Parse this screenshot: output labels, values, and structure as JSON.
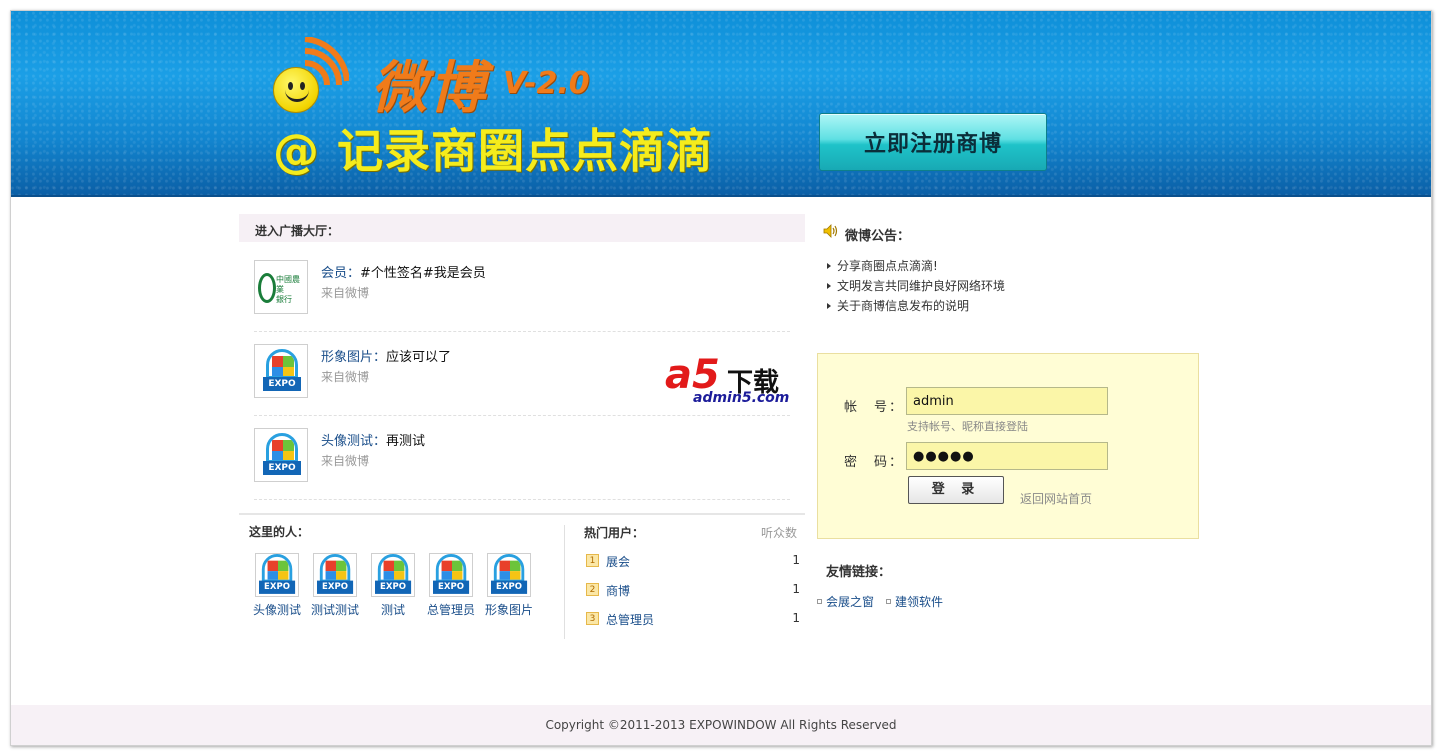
{
  "banner": {
    "brand": "微博",
    "version": "V-2.0",
    "slogan": "@ 记录商圈点点滴滴",
    "register_button": "立即注册商博"
  },
  "hall": {
    "title": "进入广播大厅：",
    "posts": [
      {
        "author": "会员：",
        "content": "#个性签名#我是会员",
        "source": "来自微博",
        "avatar": "bank-logo"
      },
      {
        "author": "形象图片：",
        "content": "应该可以了",
        "source": "来自微博",
        "avatar": "expo-logo"
      },
      {
        "author": "头像测试：",
        "content": "再测试",
        "source": "来自微博",
        "avatar": "expo-logo"
      }
    ]
  },
  "watermark": {
    "mark": "a5",
    "text": "下载",
    "url": "admin5.com"
  },
  "people": {
    "title": "这里的人：",
    "items": [
      "头像测试",
      "测试测试",
      "测试",
      "总管理员",
      "形象图片"
    ]
  },
  "hot_users": {
    "title": "热门用户：",
    "listen_label": "听众数",
    "items": [
      {
        "rank": "1",
        "name": "展会",
        "count": "1"
      },
      {
        "rank": "2",
        "name": "商博",
        "count": "1"
      },
      {
        "rank": "3",
        "name": "总管理员",
        "count": "1"
      }
    ]
  },
  "notice": {
    "title": "微博公告：",
    "items": [
      "分享商圈点点滴滴!",
      "文明发言共同维护良好网络环境",
      "关于商博信息发布的说明"
    ]
  },
  "login": {
    "account_label": "帐　号：",
    "account_value": "admin",
    "account_hint": "支持帐号、昵称直接登陆",
    "password_label": "密　码：",
    "password_value": "●●●●●",
    "submit_label": "登 录",
    "back_link": "返回网站首页"
  },
  "friend_links": {
    "title": "友情链接：",
    "items": [
      "会展之窗",
      "建领软件"
    ]
  },
  "footer": {
    "copyright": "Copyright ©2011-2013 EXPOWINDOW All Rights Reserved"
  },
  "colors": {
    "accent": "#1b9fe6",
    "brand": "#f07b1a",
    "slogan": "#f5ec1c",
    "login_bg": "#fffdd5"
  }
}
